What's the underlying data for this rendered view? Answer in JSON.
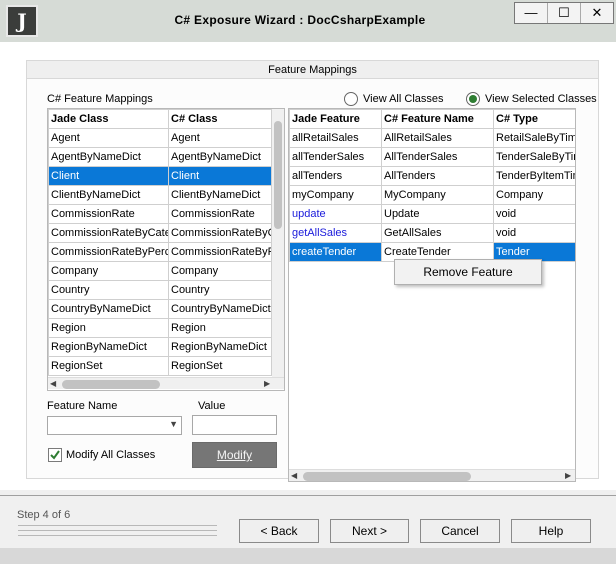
{
  "window": {
    "icon_letter": "J",
    "title": "C# Exposure Wizard  :  DocCsharpExample",
    "controls": {
      "minimize": "—",
      "maximize": "☐",
      "close": "✕"
    }
  },
  "panel": {
    "header": "Feature Mappings",
    "class_mappings_label": "C# Feature Mappings",
    "view_all_label": "View All Classes",
    "view_selected_label": "View Selected Classes",
    "view_mode": "selected"
  },
  "class_grid": {
    "columns": [
      "Jade Class",
      "C# Class"
    ],
    "rows": [
      [
        "Agent",
        "Agent"
      ],
      [
        "AgentByNameDict",
        "AgentByNameDict"
      ],
      [
        "Client",
        "Client"
      ],
      [
        "ClientByNameDict",
        "ClientByNameDict"
      ],
      [
        "CommissionRate",
        "CommissionRate"
      ],
      [
        "CommissionRateByCateg",
        "CommissionRateByCa"
      ],
      [
        "CommissionRateByPerce",
        "CommissionRateByPe"
      ],
      [
        "Company",
        "Company"
      ],
      [
        "Country",
        "Country"
      ],
      [
        "CountryByNameDict",
        "CountryByNameDict"
      ],
      [
        "Region",
        "Region"
      ],
      [
        "RegionByNameDict",
        "RegionByNameDict"
      ],
      [
        "RegionSet",
        "RegionSet"
      ]
    ],
    "selected_index": 2
  },
  "feature_grid": {
    "columns": [
      "Jade Feature",
      "C# Feature Name",
      "C# Type"
    ],
    "rows": [
      [
        "allRetailSales",
        "AllRetailSales",
        "RetailSaleByTime"
      ],
      [
        "allTenderSales",
        "AllTenderSales",
        "TenderSaleByTim"
      ],
      [
        "allTenders",
        "AllTenders",
        "TenderByItemTim"
      ],
      [
        "myCompany",
        "MyCompany",
        "Company"
      ],
      [
        "update",
        "Update",
        "void"
      ],
      [
        "getAllSales",
        "GetAllSales",
        "void"
      ],
      [
        "createTender",
        "CreateTender",
        "Tender"
      ]
    ],
    "method_rows": [
      4,
      5,
      6
    ],
    "selected_index": 6
  },
  "context_menu": {
    "remove_feature": "Remove Feature"
  },
  "feature_name_label": "Feature Name",
  "value_label": "Value",
  "feature_name_value": "",
  "value_value": "",
  "modify_all_label": "Modify All Classes",
  "modify_all_checked": true,
  "modify_button": "Modify",
  "step_text": "Step 4 of 6",
  "buttons": {
    "back": "< Back",
    "next": "Next >",
    "cancel": "Cancel",
    "help": "Help"
  },
  "colors": {
    "selection": "#0a78d7",
    "method_text": "#1a1adb",
    "radio_fill": "#2e7d32",
    "check": "#2e7d32"
  }
}
